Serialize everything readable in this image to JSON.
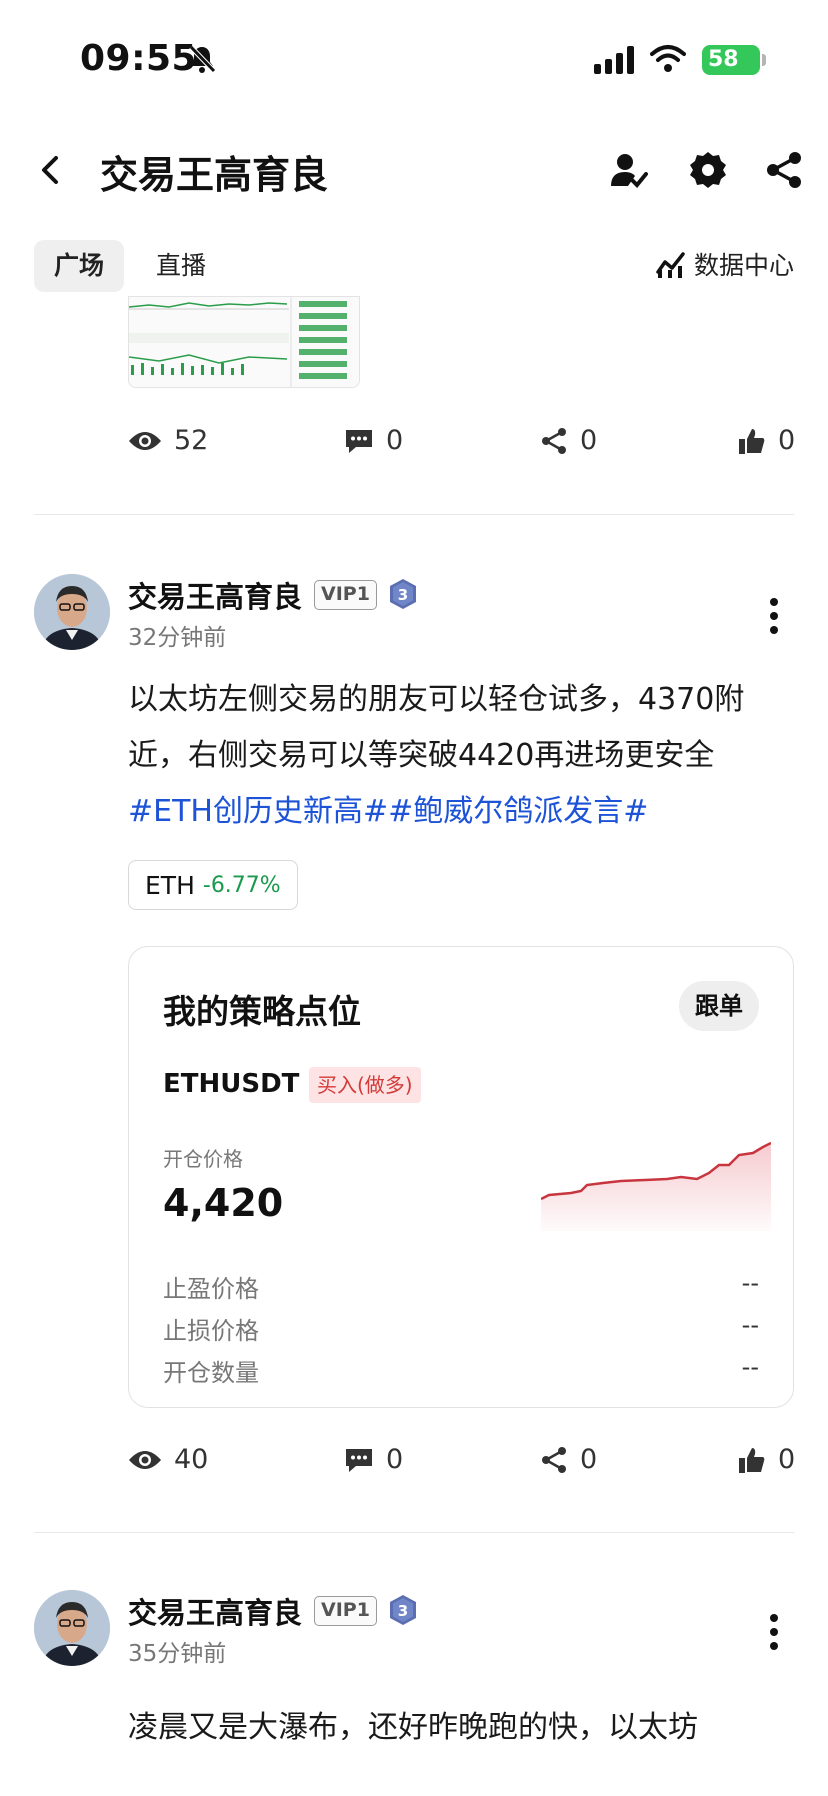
{
  "status_bar": {
    "time": "09:55",
    "battery": "58"
  },
  "header": {
    "title": "交易王高育良"
  },
  "tabs": [
    {
      "label": "广场",
      "active": true
    },
    {
      "label": "直播",
      "active": false
    }
  ],
  "data_center_label": "数据中心",
  "prev_post": {
    "stats": {
      "views": "52",
      "comments": "0",
      "shares": "0",
      "likes": "0"
    }
  },
  "post1": {
    "author": "交易王高育良",
    "vip": "VIP1",
    "level": "3",
    "time": "32分钟前",
    "text_main": "以太坊左侧交易的朋友可以轻仓试多，4370附近，右侧交易可以等突破4420再进场更安全",
    "hashtags": [
      "#ETH创历史新高#",
      "#鲍威尔鸽派发言#"
    ],
    "coin": {
      "symbol": "ETH",
      "change": "-6.77%"
    },
    "strategy": {
      "title": "我的策略点位",
      "follow_label": "跟单",
      "pair": "ETHUSDT",
      "side": "买入(做多)",
      "open_price_label": "开仓价格",
      "open_price": "4,420",
      "rows": [
        {
          "label": "止盈价格",
          "value": "--"
        },
        {
          "label": "止损价格",
          "value": "--"
        },
        {
          "label": "开仓数量",
          "value": "--"
        }
      ]
    },
    "stats": {
      "views": "40",
      "comments": "0",
      "shares": "0",
      "likes": "0"
    }
  },
  "post2": {
    "author": "交易王高育良",
    "vip": "VIP1",
    "level": "3",
    "time": "35分钟前",
    "text_partial": "凌晨又是大瀑布，还好昨晚跑的快，以太坊"
  },
  "colors": {
    "hashtag": "#1d53d6",
    "positive": "#1a9a4c",
    "buy_tag": "#d33a3a",
    "battery": "#34c759"
  }
}
